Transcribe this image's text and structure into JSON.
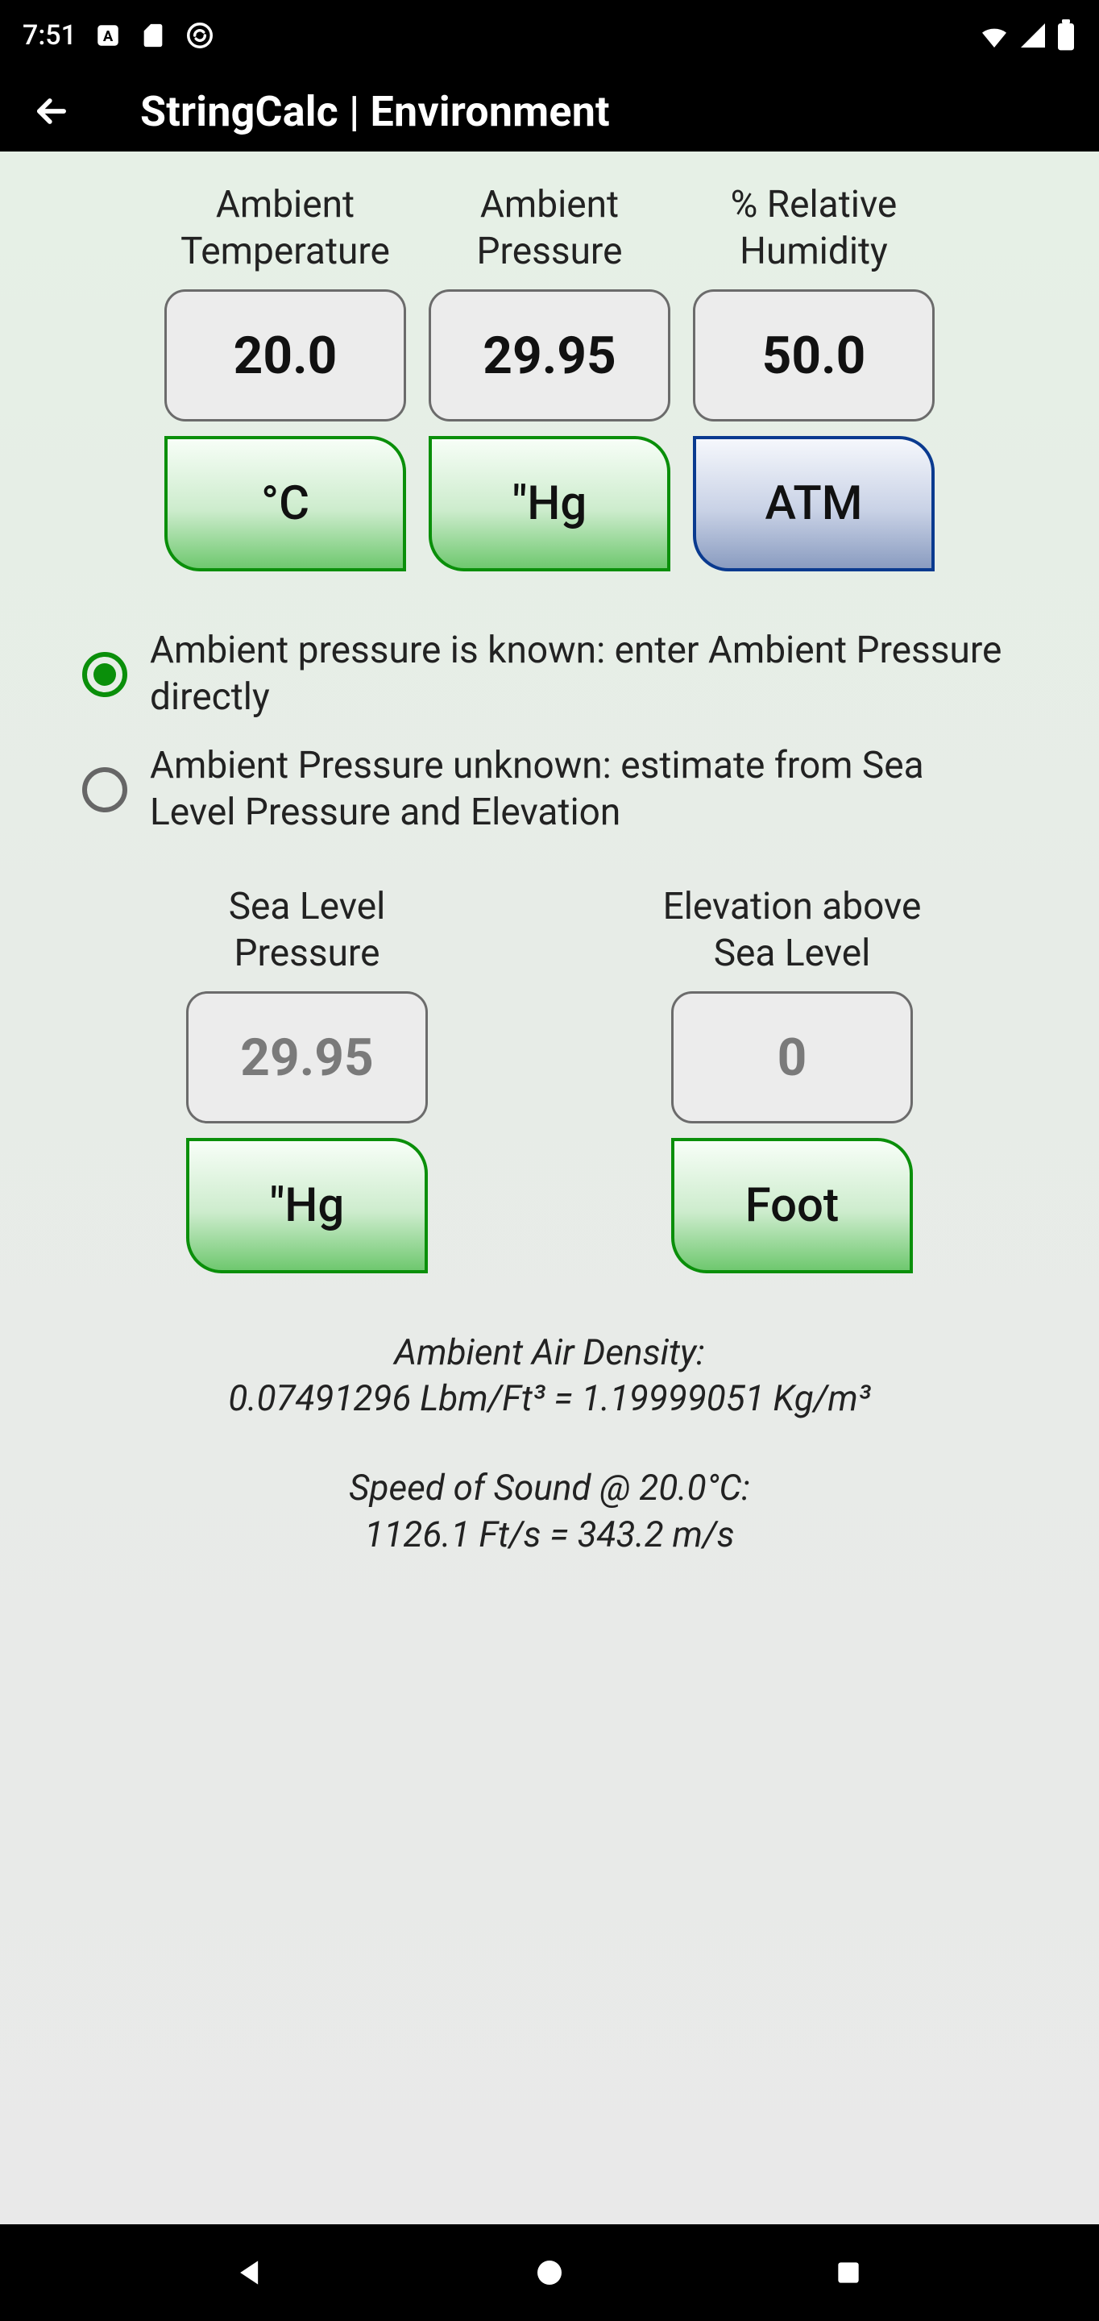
{
  "status": {
    "time": "7:51"
  },
  "appbar": {
    "title": "StringCalc | Environment"
  },
  "top": {
    "temp": {
      "label_l1": "Ambient",
      "label_l2": "Temperature",
      "value": "20.0",
      "unit": "°C"
    },
    "pressure": {
      "label_l1": "Ambient",
      "label_l2": "Pressure",
      "value": "29.95",
      "unit": "\"Hg"
    },
    "humidity": {
      "label_l1": "% Relative",
      "label_l2": "Humidity",
      "value": "50.0",
      "unit": "ATM"
    }
  },
  "radios": {
    "known": "Ambient pressure is known: enter Ambient Pressure directly",
    "unknown": "Ambient Pressure unknown: estimate from Sea Level Pressure and Elevation"
  },
  "bottom": {
    "slp": {
      "label_l1": "Sea Level",
      "label_l2": "Pressure",
      "value": "29.95",
      "unit": "\"Hg"
    },
    "elev": {
      "label_l1": "Elevation above",
      "label_l2": "Sea Level",
      "value": "0",
      "unit": "Foot"
    }
  },
  "results": {
    "density_label": "Ambient Air Density:",
    "density_value": "0.07491296 Lbm/Ft³ = 1.19999051 Kg/m³",
    "sos_label": "Speed of Sound @ 20.0°C:",
    "sos_value": "1126.1 Ft/s = 343.2 m/s"
  }
}
